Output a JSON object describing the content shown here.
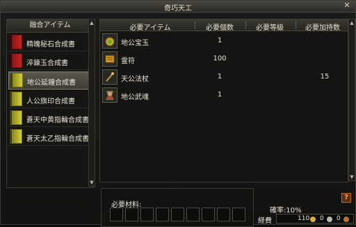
{
  "window": {
    "title": "奇巧天工",
    "close_glyph": "✕"
  },
  "recipe_list": {
    "header": "融合アイテム",
    "items": [
      {
        "label": "精魄秘石合成書",
        "book": "red",
        "selected": false
      },
      {
        "label": "淬錬玉合成書",
        "book": "red",
        "selected": false
      },
      {
        "label": "地公延鐘合成書",
        "book": "yellow",
        "selected": true
      },
      {
        "label": "人公旗印合成書",
        "book": "yellow",
        "selected": false
      },
      {
        "label": "蒼天中黄指輪合成書",
        "book": "yellow",
        "selected": false
      },
      {
        "label": "蒼天太乙指輪合成書",
        "book": "yellow",
        "selected": false
      }
    ]
  },
  "requirements": {
    "headers": {
      "item": "必要アイテム",
      "count": "必要個数",
      "level": "必要等級",
      "durability": "必要加持数"
    },
    "rows": [
      {
        "name": "地公宝玉",
        "count": "1",
        "level": "",
        "durability": "",
        "icon": "jade-orb-icon"
      },
      {
        "name": "霊符",
        "count": "100",
        "level": "",
        "durability": "",
        "icon": "talisman-icon"
      },
      {
        "name": "天公法杖",
        "count": "1",
        "level": "",
        "durability": "15",
        "icon": "staff-icon"
      },
      {
        "name": "地公武魂",
        "count": "1",
        "level": "",
        "durability": "",
        "icon": "warrior-soul-icon"
      }
    ]
  },
  "materials": {
    "label": "必要材料:"
  },
  "success_rate": "確率:10%",
  "cost": {
    "label": "経費",
    "gold": "110",
    "silver": "0",
    "copper": "0"
  },
  "help_glyph": "?",
  "colors": {
    "accent_red": "#c62222",
    "accent_yellow": "#d3cf3a",
    "help_orange": "#c56d1d"
  }
}
